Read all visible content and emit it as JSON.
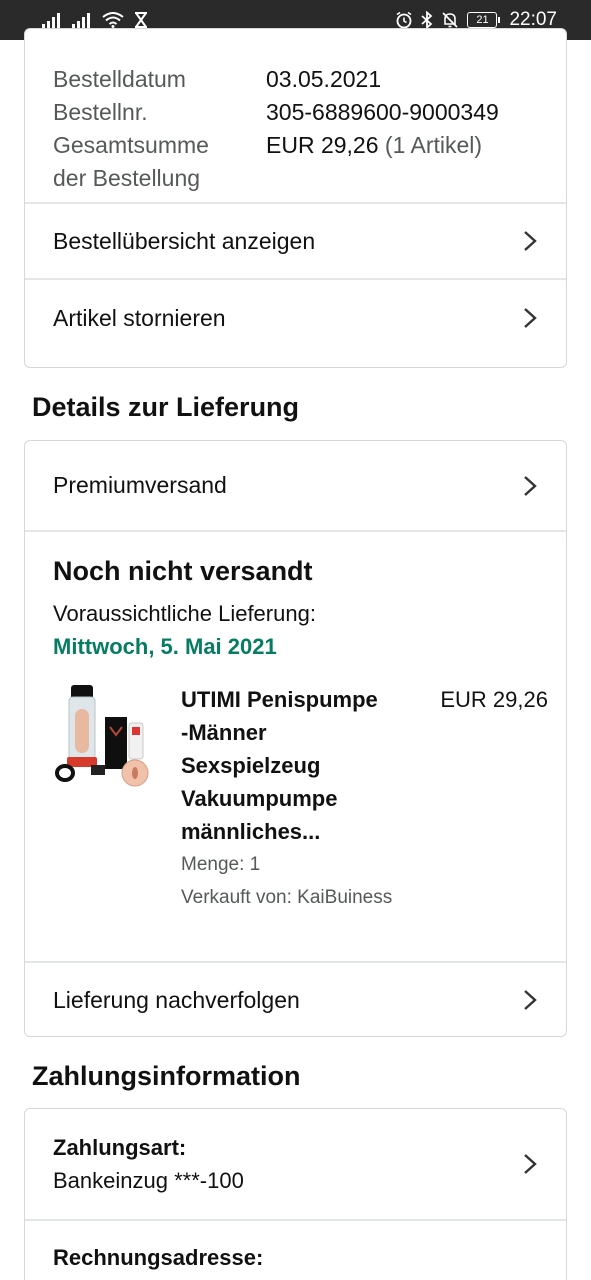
{
  "status_bar": {
    "time": "22:07",
    "battery": "21"
  },
  "order_summary": {
    "rows": [
      {
        "label": "Bestelldatum",
        "value": "03.05.2021"
      },
      {
        "label": "Bestellnr.",
        "value": "305-6889600-9000349"
      }
    ],
    "total_label_line1": "Gesamtsumme",
    "total_label_line2": "der Bestellung",
    "total_value": "EUR 29,26",
    "total_items": "(1 Artikel)",
    "links": {
      "view_order": "Bestellübersicht anzeigen",
      "cancel_items": "Artikel stornieren"
    }
  },
  "delivery": {
    "section_title": "Details zur Lieferung",
    "shipping_method": "Premiumversand",
    "status": "Noch nicht versandt",
    "expected_label": "Voraussichtliche Lieferung:",
    "expected_date": "Mittwoch, 5. Mai 2021",
    "product": {
      "title_lines": [
        "UTIMI Penispumpe",
        "-Männer",
        "Sexspielzeug",
        "Vakuumpumpe",
        "männliches..."
      ],
      "price": "EUR 29,26",
      "quantity": "Menge: 1",
      "seller": "Verkauft von: KaiBuiness"
    },
    "track_link": "Lieferung nachverfolgen"
  },
  "payment": {
    "section_title": "Zahlungsinformation",
    "method_label": "Zahlungsart:",
    "method_value": "Bankeinzug ***-100",
    "billing_label": "Rechnungsadresse:"
  },
  "colors": {
    "accent_green": "#067d62",
    "status_bar": "#2a2a2a",
    "border": "#d5d9d9"
  }
}
